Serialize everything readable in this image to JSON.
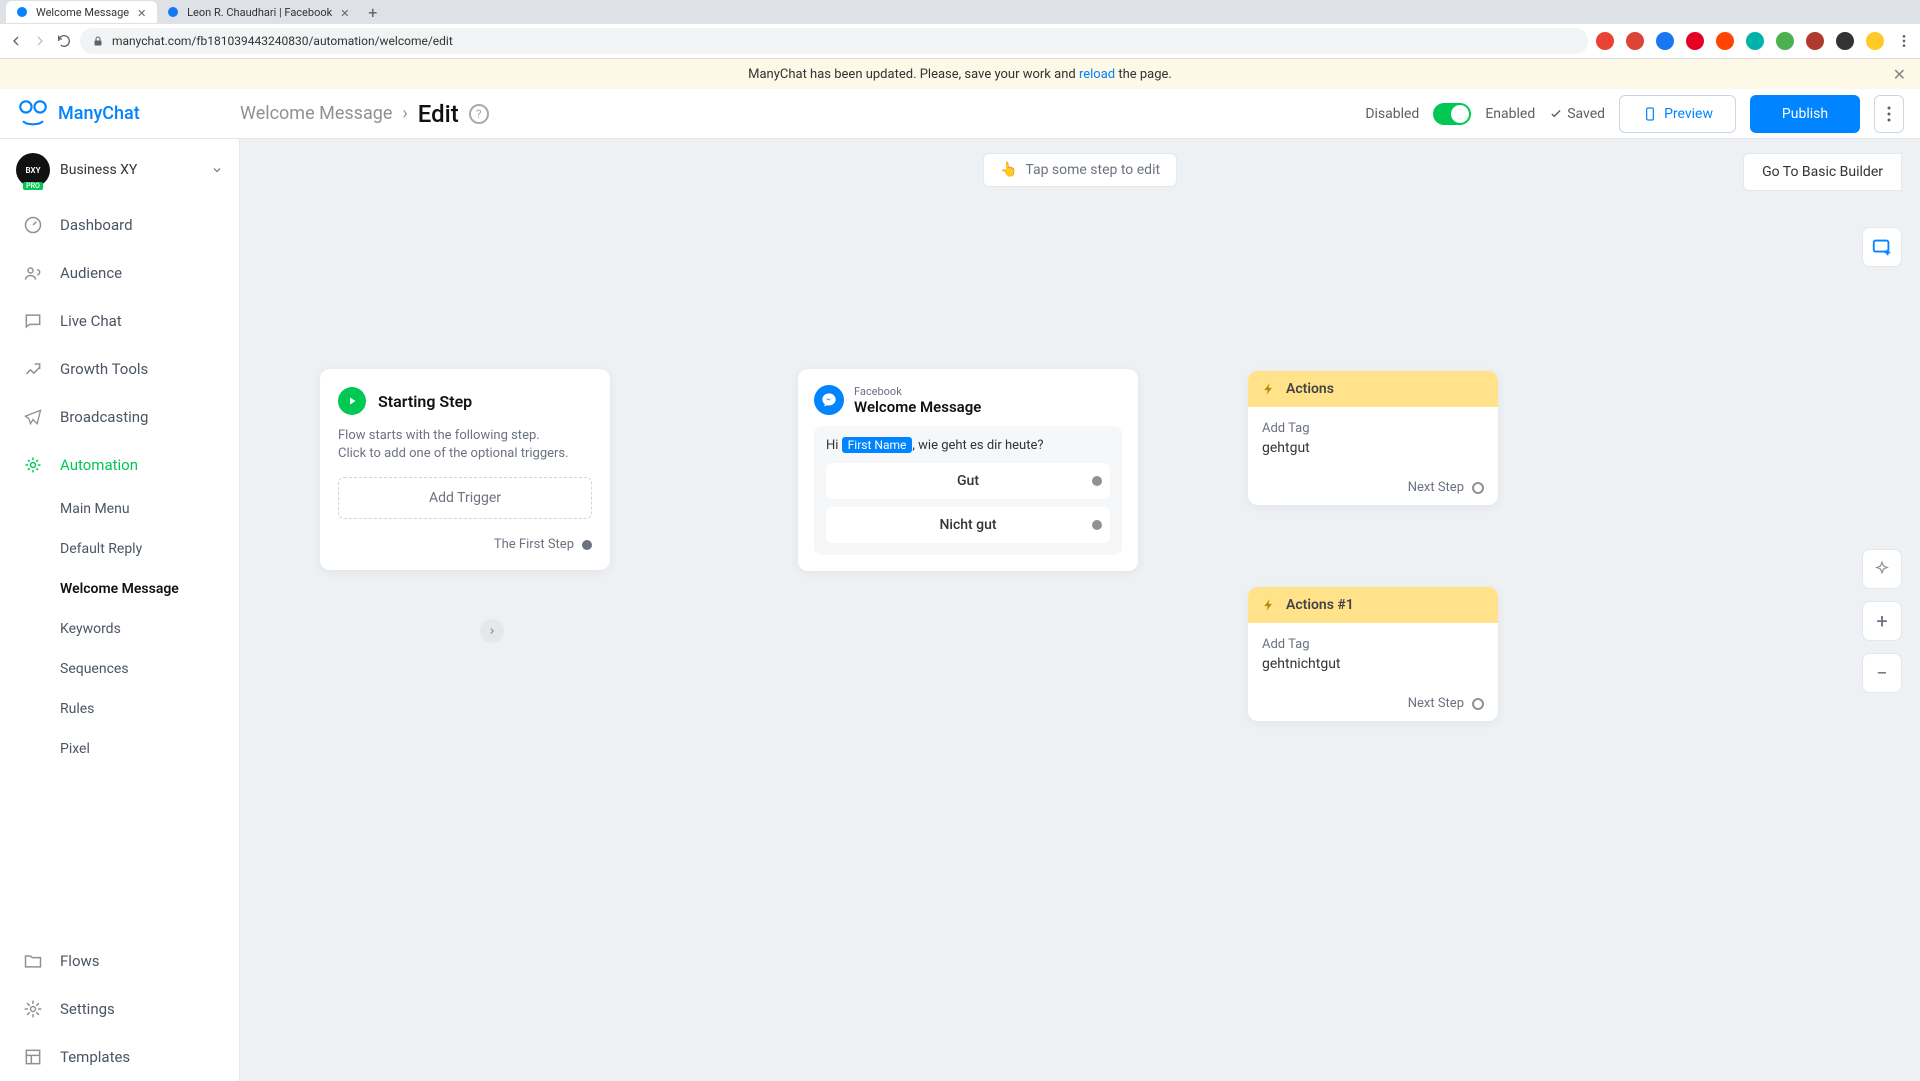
{
  "browser": {
    "tabs": [
      {
        "title": "Welcome Message",
        "active": true
      },
      {
        "title": "Leon R. Chaudhari | Facebook",
        "active": false
      }
    ],
    "url": "manychat.com/fb181039443240830/automation/welcome/edit"
  },
  "banner": {
    "pre": "ManyChat has been updated. Please, save your work and ",
    "link": "reload",
    "post": " the page."
  },
  "brand": "ManyChat",
  "breadcrumb": {
    "parent": "Welcome Message",
    "current": "Edit"
  },
  "header": {
    "disabled": "Disabled",
    "enabled": "Enabled",
    "saved": "Saved",
    "preview": "Preview",
    "publish": "Publish",
    "basic_builder": "Go To Basic Builder"
  },
  "account": {
    "name": "Business XY",
    "badge": "PRO"
  },
  "nav": {
    "dashboard": "Dashboard",
    "audience": "Audience",
    "live_chat": "Live Chat",
    "growth_tools": "Growth Tools",
    "broadcasting": "Broadcasting",
    "automation": "Automation",
    "flows": "Flows",
    "settings": "Settings",
    "templates": "Templates",
    "sub": {
      "main_menu": "Main Menu",
      "default_reply": "Default Reply",
      "welcome_message": "Welcome Message",
      "keywords": "Keywords",
      "sequences": "Sequences",
      "rules": "Rules",
      "pixel": "Pixel"
    }
  },
  "canvas": {
    "hint": "Tap some step to edit",
    "start": {
      "title": "Starting Step",
      "desc": "Flow starts with the following step.\nClick to add one of the optional triggers.",
      "add_trigger": "Add Trigger",
      "first_step": "The First Step"
    },
    "message": {
      "subtitle": "Facebook",
      "title": "Welcome Message",
      "text_pre": "Hi ",
      "var": "First Name",
      "text_post": ", wie geht es dir heute?",
      "reply1": "Gut",
      "reply2": "Nicht gut"
    },
    "action1": {
      "title": "Actions",
      "label": "Add Tag",
      "value": "gehtgut",
      "next": "Next Step"
    },
    "action2": {
      "title": "Actions #1",
      "label": "Add Tag",
      "value": "gehtnichtgut",
      "next": "Next Step"
    }
  }
}
